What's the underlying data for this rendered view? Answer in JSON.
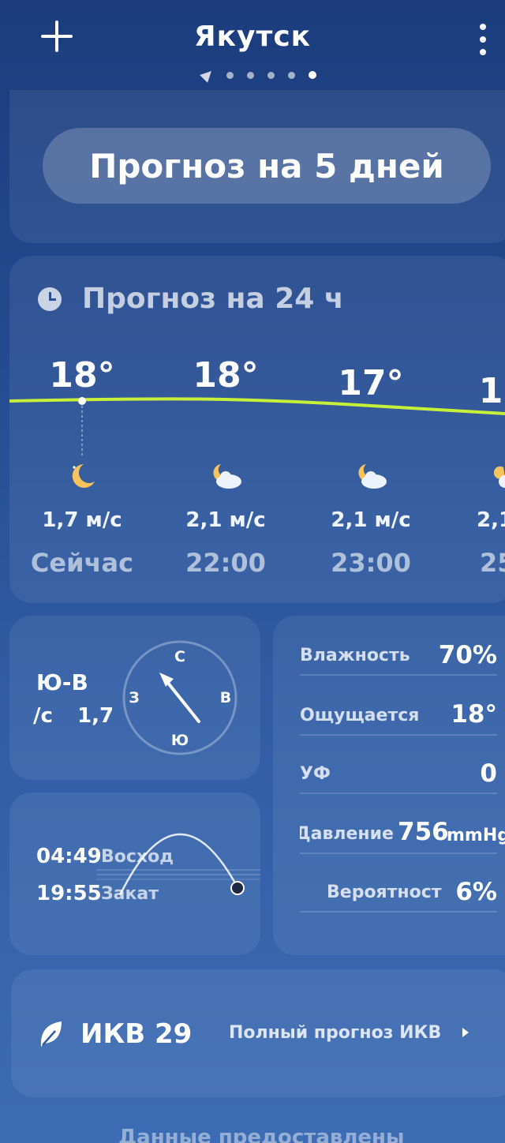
{
  "header": {
    "city": "Якутск"
  },
  "five_day_button": "Прогноз на 5 дней",
  "hourly": {
    "title": "Прогноз на 24 ч",
    "items": [
      {
        "temp": "18°",
        "wind": "1,7 м/с",
        "time": "Сейчас",
        "icon": "moon-icon"
      },
      {
        "temp": "18°",
        "wind": "2,1 м/с",
        "time": "22:00",
        "icon": "partly-cloudy-night-icon"
      },
      {
        "temp": "17°",
        "wind": "2,1 м/с",
        "time": "23:00",
        "icon": "partly-cloudy-night-icon"
      },
      {
        "temp": "1",
        "wind": "2,1",
        "time": "25",
        "icon": "partly-cloudy-night-icon"
      }
    ],
    "temperature_curve_values": [
      18,
      18,
      17,
      17
    ]
  },
  "wind": {
    "direction": "Ю-В",
    "unit": "/с",
    "speed": "1,7",
    "compass": {
      "n": "С",
      "e": "В",
      "s": "Ю",
      "w": "З"
    }
  },
  "details": [
    {
      "label": "Влажность",
      "value": "70%"
    },
    {
      "label": "Ощущается",
      "value": "18°"
    },
    {
      "label": "УФ",
      "value": "0"
    },
    {
      "label": "Давление",
      "value": "756",
      "unit": "mmHg"
    },
    {
      "label": "Вероятност",
      "value": "6%"
    }
  ],
  "sun": {
    "sunrise_time": "04:49",
    "sunrise_label": "Восход",
    "sunset_time": "19:55",
    "sunset_label": "Закат"
  },
  "aqi": {
    "label": "ИКВ 29",
    "link": "Полный прогноз ИКВ"
  },
  "footer": "Данные предоставлены",
  "colors": {
    "bg_top": "#1c3c7c",
    "bg_bottom": "#3c6cb4",
    "temp_line": "#c8f03a",
    "moon": "#f6c45a"
  }
}
